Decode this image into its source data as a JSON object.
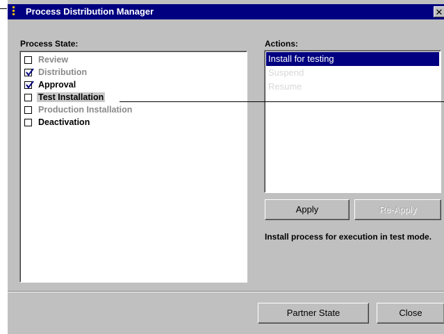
{
  "window": {
    "title": "Process Distribution Manager",
    "close_glyph": "✕"
  },
  "process_state": {
    "label": "Process State:",
    "items": [
      {
        "label": "Review",
        "checked": false,
        "enabled": false,
        "highlighted": false
      },
      {
        "label": "Distribution",
        "checked": true,
        "enabled": false,
        "highlighted": false
      },
      {
        "label": "Approval",
        "checked": true,
        "enabled": true,
        "highlighted": false
      },
      {
        "label": "Test Installation",
        "checked": false,
        "enabled": true,
        "highlighted": true
      },
      {
        "label": "Production Installation",
        "checked": false,
        "enabled": false,
        "highlighted": false
      },
      {
        "label": "Deactivation",
        "checked": false,
        "enabled": true,
        "highlighted": false
      }
    ]
  },
  "actions": {
    "label": "Actions:",
    "items": [
      {
        "label": "Install for testing",
        "selected": true,
        "enabled": true
      },
      {
        "label": "Suspend",
        "selected": false,
        "enabled": false
      },
      {
        "label": "Resume",
        "selected": false,
        "enabled": false
      }
    ],
    "apply_label": "Apply",
    "reapply_label": "Re-Apply",
    "description": "Install process for execution in test mode."
  },
  "footer": {
    "partner_state_label": "Partner State",
    "close_label": "Close"
  },
  "colors": {
    "title_bar": "#000080",
    "window_bg": "#c0c0c0",
    "selection": "#000080",
    "disabled_text": "#8a8a8a"
  },
  "icons": {
    "app": "app-icon",
    "close": "close-icon",
    "checkbox_checked": "checkmark-icon"
  }
}
